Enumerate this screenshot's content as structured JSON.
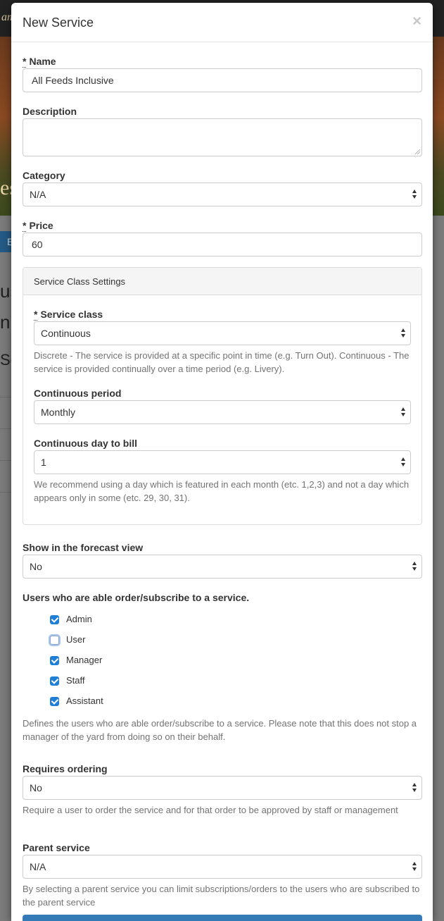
{
  "background": {
    "logo_fragment": "am",
    "hero_fragment": "es",
    "button_fragment": "E",
    "text_fragments": [
      "us",
      "n't",
      "Se"
    ]
  },
  "modal": {
    "title": "New Service",
    "close_glyph": "×",
    "required_mark": "*"
  },
  "form": {
    "name": {
      "label": "Name",
      "value": "All Feeds Inclusive"
    },
    "description": {
      "label": "Description",
      "value": ""
    },
    "category": {
      "label": "Category",
      "value": "N/A"
    },
    "price": {
      "label": "Price",
      "value": "60"
    },
    "panel": {
      "title": "Service Class Settings",
      "service_class": {
        "label": "Service class",
        "value": "Continuous",
        "help": "Discrete - The service is provided at a specific point in time (e.g. Turn Out). Continuous - The service is provided continually over a time period (e.g. Livery)."
      },
      "continuous_period": {
        "label": "Continuous period",
        "value": "Monthly"
      },
      "continuous_day": {
        "label": "Continuous day to bill",
        "value": "1",
        "help": "We recommend using a day which is featured in each month (etc. 1,2,3) and not a day which appears only in some (etc. 29, 30, 31)."
      }
    },
    "forecast": {
      "label": "Show in the forecast view",
      "value": "No"
    },
    "users": {
      "label": "Users who are able order/subscribe to a service.",
      "options": [
        {
          "label": "Admin",
          "checked": true
        },
        {
          "label": "User",
          "checked": false
        },
        {
          "label": "Manager",
          "checked": true
        },
        {
          "label": "Staff",
          "checked": true
        },
        {
          "label": "Assistant",
          "checked": true
        }
      ],
      "help": "Defines the users who are able order/subscribe to a service. Please note that this does not stop a manager of the yard from doing so on their behalf."
    },
    "requires_ordering": {
      "label": "Requires ordering",
      "value": "No",
      "help": "Require a user to order the service and for that order to be approved by staff or management"
    },
    "parent_service": {
      "label": "Parent service",
      "value": "N/A",
      "help": "By selecting a parent service you can limit subscriptions/orders to the users who are subscribed to the parent service"
    }
  },
  "colors": {
    "primary": "#337ab7",
    "checkbox_checked": "#1f7fd6",
    "help_text": "#737373"
  }
}
